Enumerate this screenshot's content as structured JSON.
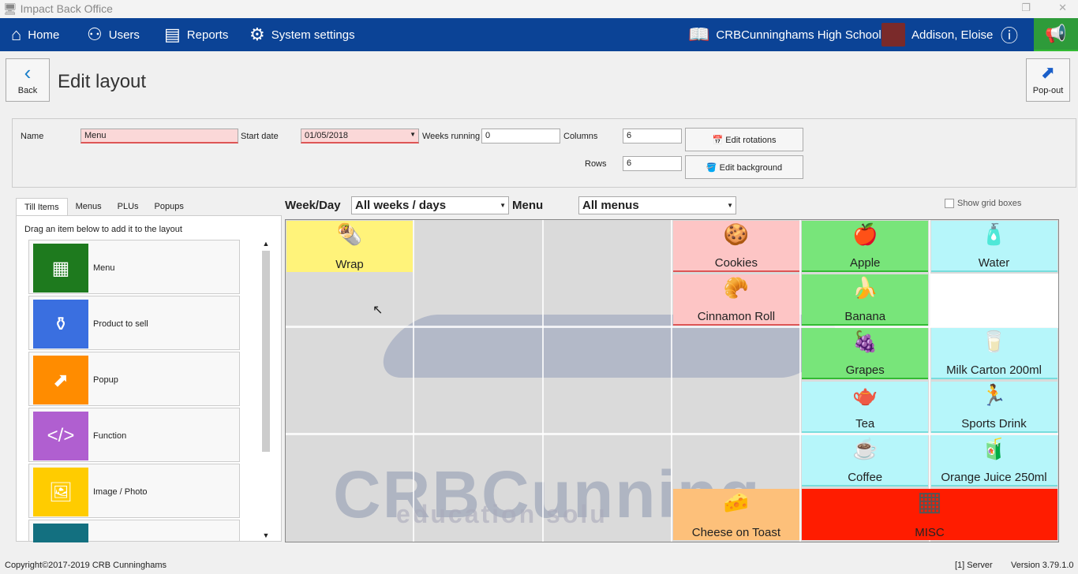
{
  "window": {
    "title": "Impact Back Office"
  },
  "nav": {
    "home": "Home",
    "users": "Users",
    "reports": "Reports",
    "settings": "System settings",
    "school": "CRBCunninghams High School",
    "user": "Addison, Eloise"
  },
  "page": {
    "back": "Back",
    "title": "Edit layout",
    "popout": "Pop-out"
  },
  "form": {
    "name_label": "Name",
    "name_value": "Menu",
    "start_label": "Start date",
    "start_value": "01/05/2018",
    "weeks_label": "Weeks running",
    "weeks_value": "0",
    "columns_label": "Columns",
    "columns_value": "6",
    "rows_label": "Rows",
    "rows_value": "6",
    "edit_rotations": "Edit rotations",
    "edit_background": "Edit background"
  },
  "left": {
    "tabs": [
      "Till Items",
      "Menus",
      "PLUs",
      "Popups"
    ],
    "hint": "Drag an item below to add it to the layout",
    "items": [
      {
        "label": "Menu",
        "color": "#1e7a1e"
      },
      {
        "label": "Product to sell",
        "color": "#3a6fe0"
      },
      {
        "label": "Popup",
        "color": "#ff8c00"
      },
      {
        "label": "Function",
        "color": "#b05fd0"
      },
      {
        "label": "Image / Photo",
        "color": "#ffcc00"
      }
    ]
  },
  "filters": {
    "weekday_label": "Week/Day",
    "weekday_value": "All weeks / days",
    "menu_label": "Menu",
    "menu_value": "All menus",
    "show_grid": "Show grid boxes"
  },
  "watermark": {
    "line1": "CRBCunning",
    "line2": "education solu"
  },
  "cells": [
    {
      "label": "Wrap",
      "icon": "🌯",
      "color": "yellow",
      "col": 0,
      "row": 0
    },
    {
      "label": "Cookies",
      "icon": "🍪",
      "color": "pink",
      "col": 3,
      "row": 0
    },
    {
      "label": "Cinnamon Roll",
      "icon": "🥐",
      "color": "pink",
      "col": 3,
      "row": 1
    },
    {
      "label": "Cheese on Toast",
      "icon": "🧀",
      "color": "orange",
      "col": 3,
      "row": 5
    },
    {
      "label": "Apple",
      "icon": "🍎",
      "color": "green",
      "col": 4,
      "row": 0
    },
    {
      "label": "Banana",
      "icon": "🍌",
      "color": "green",
      "col": 4,
      "row": 1
    },
    {
      "label": "Grapes",
      "icon": "🍇",
      "color": "green",
      "col": 4,
      "row": 2
    },
    {
      "label": "Tea",
      "icon": "🫖",
      "color": "cyan",
      "col": 4,
      "row": 3
    },
    {
      "label": "Coffee",
      "icon": "☕",
      "color": "cyan",
      "col": 4,
      "row": 4
    },
    {
      "label": "Water",
      "icon": "🧴",
      "color": "cyan",
      "col": 5,
      "row": 0
    },
    {
      "label": "Milk Carton 200ml",
      "icon": "🥛",
      "color": "cyan",
      "col": 5,
      "row": 2
    },
    {
      "label": "Sports Drink",
      "icon": "🏃",
      "color": "cyan",
      "col": 5,
      "row": 3
    },
    {
      "label": "Orange Juice 250ml",
      "icon": "🧃",
      "color": "cyan",
      "col": 5,
      "row": 4
    },
    {
      "label": "MISC",
      "icon": "▦",
      "color": "red",
      "col": 4,
      "row": 5,
      "span": 2
    }
  ],
  "footer": {
    "copyright": "Copyright©2017-2019 CRB Cunninghams",
    "server": "[1] Server",
    "version": "Version 3.79.1.0"
  }
}
